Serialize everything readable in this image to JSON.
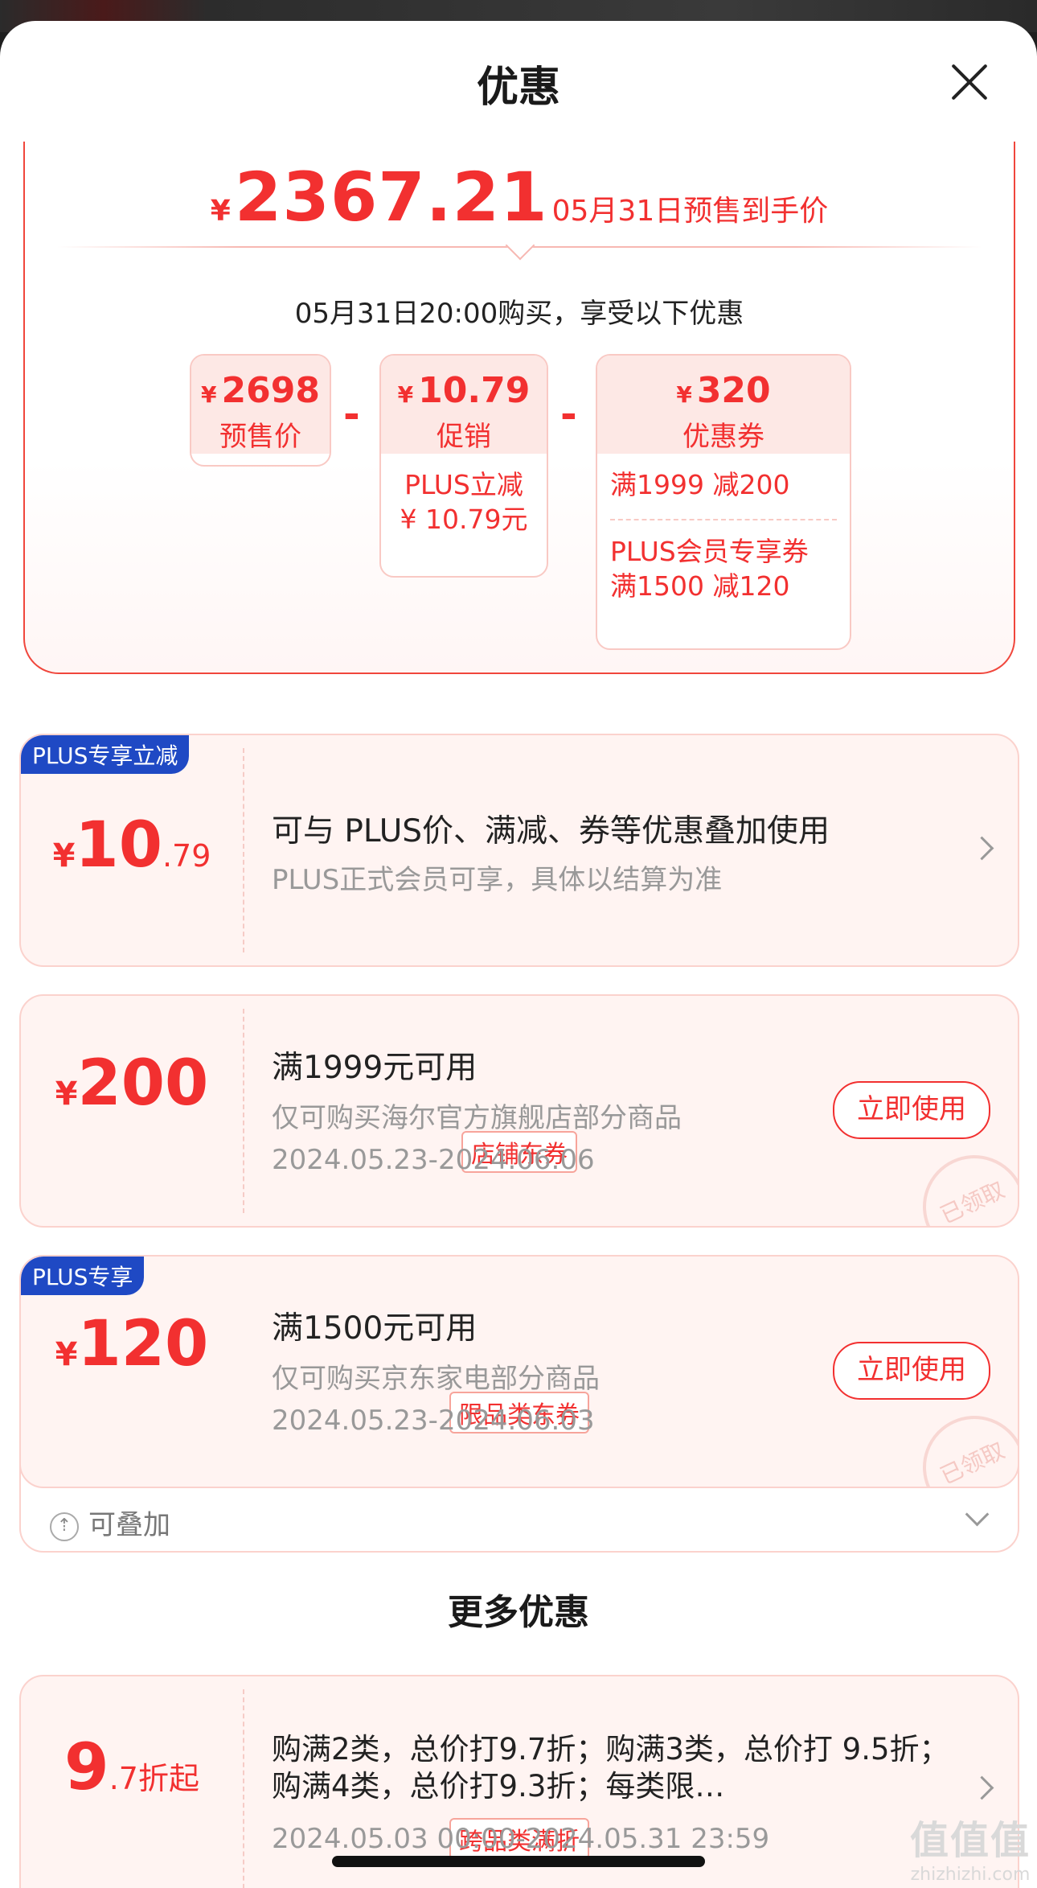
{
  "header": {
    "title": "优惠"
  },
  "summary": {
    "currency": "¥",
    "final_price": "2367.21",
    "final_desc": "05月31日预售到手价",
    "buy_tip": "05月31日20:00购买，享受以下优惠",
    "boxes": [
      {
        "amount": "2698",
        "label": "预售价",
        "details": []
      },
      {
        "amount": "10.79",
        "label": "促销",
        "details": [
          "PLUS立减 ¥ 10.79元"
        ]
      },
      {
        "amount": "320",
        "label": "优惠券",
        "details": [
          "满1999 减200",
          "PLUS会员专享券 满1500 减120"
        ]
      }
    ],
    "minus": "-"
  },
  "cards": [
    {
      "tag": "PLUS专享立减",
      "currency": "¥",
      "int": "10",
      "dec": ".79",
      "line1": "可与 PLUS价、满减、券等优惠叠加使用",
      "line2": "PLUS正式会员可享，具体以结算为准"
    },
    {
      "currency": "¥",
      "int": "200",
      "type_tag": "店铺东券",
      "line1": "满1999元可用",
      "line2": "仅可购买海尔官方旗舰店部分商品",
      "line3": "2024.05.23-2024.06.06",
      "button": "立即使用",
      "stamp": "已领取"
    },
    {
      "tag": "PLUS专享",
      "currency": "¥",
      "int": "120",
      "type_tag": "限品类东券",
      "line1": "满1500元可用",
      "line2": "仅可购买京东家电部分商品",
      "line3": "2024.05.23-2024.06.03",
      "button": "立即使用",
      "stamp": "已领取"
    }
  ],
  "stackable": {
    "label": "可叠加",
    "icon": "stack-arrow-icon"
  },
  "more": {
    "title": "更多优惠",
    "card": {
      "int": "9",
      "suffix": ".7折起",
      "type_tag": "跨品类满折",
      "text": "购满2类，总价打9.7折；购满3类，总价打 9.5折；购满4类，总价打9.3折；每类限…",
      "date": "2024.05.03 00:00-2024.05.31 23:59"
    }
  },
  "watermark": {
    "logo": "值值值",
    "site": "zhizhizhi.com"
  }
}
